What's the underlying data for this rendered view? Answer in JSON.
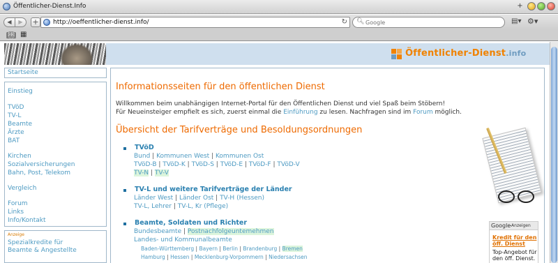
{
  "window": {
    "title": "Öffentlicher-Dienst.Info"
  },
  "toolbar": {
    "url": "http://oeffentlicher-dienst.info/",
    "search_placeholder": "Google"
  },
  "logo": {
    "text": "Öffentlicher-Dienst",
    "suffix": ".info"
  },
  "sidebar": {
    "start": "Startseite",
    "items": [
      "Einstieg",
      "TVöD",
      "TV-L",
      "Beamte",
      "Ärzte",
      "BAT",
      "Kirchen",
      "Sozialversicherungen",
      "Bahn, Post, Telekom",
      "Vergleich",
      "Forum",
      "Links",
      "Info/Kontakt"
    ],
    "ad_tag": "Anzeige",
    "ad_lines": [
      "Spezialkredite für",
      "Beamte & Angestellte"
    ]
  },
  "content": {
    "heading": "Informationsseiten für den öffentlichen Dienst",
    "intro1": "Willkommen beim unabhängigen Internet-Portal für den Öffentlichen Dienst und viel Spaß beim Stöbern!",
    "intro2_a": "Für Neueinsteiger empfielt es sich, zuerst einmal die ",
    "intro2_link1": "Einführung",
    "intro2_b": " zu lesen. Nachfragen sind im ",
    "intro2_link2": "Forum",
    "intro2_c": " möglich.",
    "heading2": "Übersicht der Tarifverträge und Besoldungsordnungen",
    "sep": " | ",
    "tvod": {
      "title": "TVöD",
      "row1": [
        "Bund",
        "Kommunen West",
        "Kommunen Ost"
      ],
      "row2": [
        "TVöD-B",
        "TVöD-K",
        "TVöD-S",
        "TVöD-E",
        "TVöD-F",
        "TVöD-V"
      ],
      "row3": [
        "TV-N",
        "TV-V"
      ]
    },
    "tvl": {
      "title": "TV-L und weitere Tarifverträge der Länder",
      "row1": [
        "Länder West",
        "Länder Ost",
        "TV-H (Hessen)"
      ],
      "row2": [
        "TV-L, Lehrer",
        "TV-L, Kr (Pflege)"
      ]
    },
    "beamte": {
      "title": "Beamte, Soldaten und Richter",
      "row1": [
        "Bundesbeamte",
        "Postnachfolgeuntemehmen"
      ],
      "row2": "Landes- und Kommunalbeamte",
      "row3": [
        "Baden-Württemberg",
        "Bayern",
        "Berlin",
        "Brandenburg",
        "Bremen"
      ],
      "row4": [
        "Hamburg",
        "Hessen",
        "Mecklenburg-Vorpommern",
        "Niedersachsen"
      ]
    }
  },
  "google_ad": {
    "logo": "Google",
    "label": "-Anzeigen",
    "title": "Kredit für den öff. Dienst",
    "text": "Top-Angebot für den öff. Dienst."
  }
}
